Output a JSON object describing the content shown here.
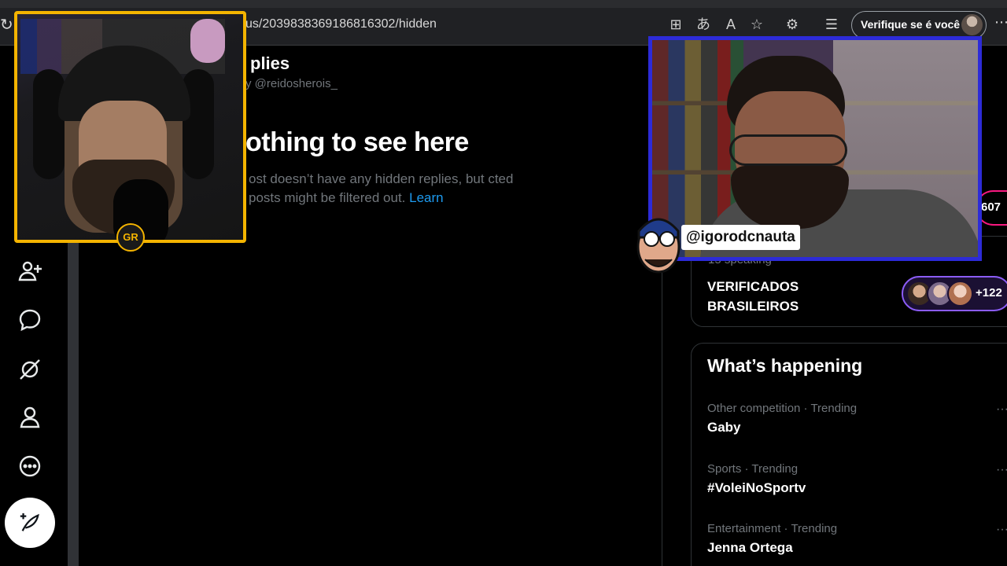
{
  "browser": {
    "url": "us/2039838369186816302/hidden",
    "verify_label": "Verifique se é você",
    "icons": [
      "reload-icon",
      "apps-icon",
      "translate-icon",
      "read-aloud-icon",
      "favorite-star-icon",
      "extensions-icon",
      "favorites-list-icon",
      "more-icon"
    ]
  },
  "sidebar": {
    "icons": [
      "follow-icon",
      "messages-icon",
      "premium-icon",
      "profile-icon",
      "more-circle-icon"
    ],
    "compose_icon": "compose-feather-icon"
  },
  "main": {
    "title": "plies",
    "subtitle": "y @reidosherois_",
    "empty_heading": "othing to see here",
    "empty_body": "ost doesn’t have any hidden replies, but cted posts might be filtered out.",
    "learn_link": "Learn"
  },
  "space": {
    "listening_count": "607",
    "speaking_text": "15 speaking",
    "title_line1": "VERIFICADOS",
    "title_line2": "BRASILEIROS",
    "participants_more": "+122"
  },
  "trending": {
    "heading": "What’s happening",
    "items": [
      {
        "meta": "Other competition · Trending",
        "name": "Gaby"
      },
      {
        "meta": "Sports · Trending",
        "name": "#VoleiNoSportv"
      },
      {
        "meta": "Entertainment · Trending",
        "name": "Jenna Ortega"
      }
    ],
    "more_glyph": "···"
  },
  "overlays": {
    "streamer_tag": "@igorodcnauta",
    "badge_text": "GR"
  },
  "colors": {
    "accent_link": "#1d9bf0",
    "left_cam_border": "#f4b400",
    "right_cam_border": "#2d2bd8",
    "space_pill_border": "#8b5cf6",
    "listen_pill_border": "#f91880"
  }
}
